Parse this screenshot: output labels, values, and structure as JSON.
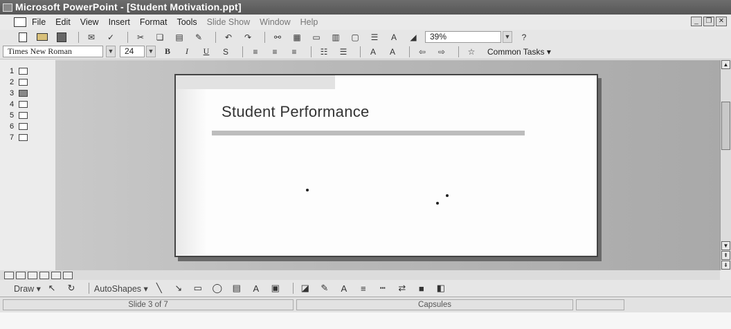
{
  "window": {
    "title": "Microsoft PowerPoint - [Student Motivation.ppt]"
  },
  "menu": [
    "File",
    "Edit",
    "View",
    "Insert",
    "Format",
    "Tools",
    "Slide Show",
    "Window",
    "Help"
  ],
  "formatting": {
    "font": "Times New Roman",
    "size": "24",
    "bold": "B",
    "italic": "I",
    "underline": "U",
    "zoom": "39%",
    "common_tasks": "Common Tasks"
  },
  "thumbnails": [
    "1",
    "2",
    "3",
    "4",
    "5",
    "6",
    "7"
  ],
  "active_slide_index": 3,
  "slide": {
    "title": "Student Performance"
  },
  "drawing": {
    "draw_label": "Draw",
    "autoshapes_label": "AutoShapes"
  },
  "status": {
    "slide_position": "Slide 3 of 7",
    "design": "Capsules"
  },
  "icons": [
    "new-icon",
    "open-icon",
    "save-icon",
    "email-icon",
    "spelling-icon",
    "cut-icon",
    "copy-icon",
    "paste-icon",
    "format-painter-icon",
    "undo-icon",
    "redo-icon",
    "insert-chart-icon",
    "insert-table-icon",
    "help-icon"
  ]
}
